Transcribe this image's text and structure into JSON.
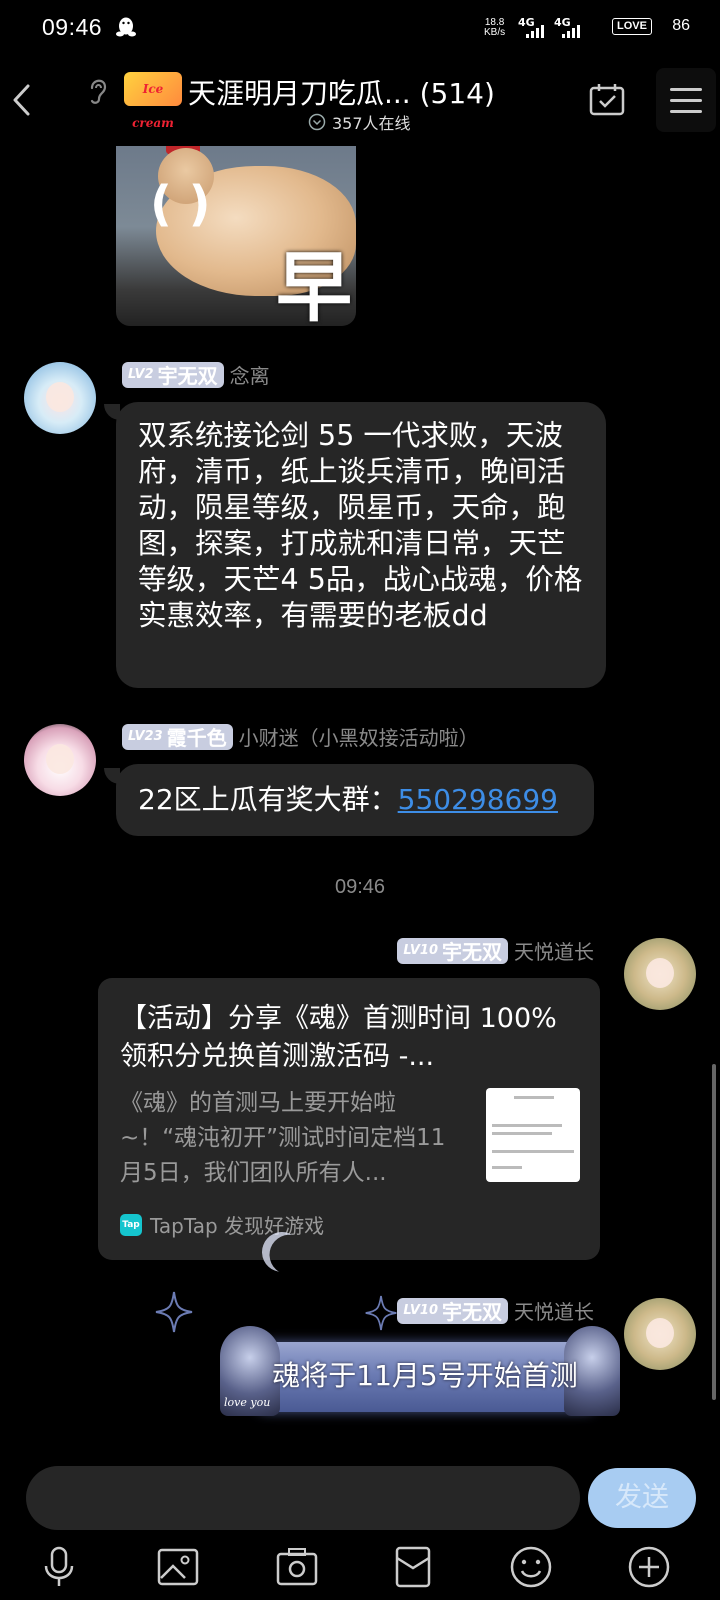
{
  "status_bar": {
    "time": "09:46",
    "net_speed_value": "18.8",
    "net_speed_unit": "KB/s",
    "sim1": "4G",
    "sim2": "4G",
    "battery_label": "LOVE",
    "battery_level": "86"
  },
  "header": {
    "title": "天涯明月刀吃瓜... (514)",
    "online": "357人在线",
    "logo_text": "Ice cream"
  },
  "messages": [
    {
      "type": "sticker",
      "sticker_text": "早"
    },
    {
      "side": "left",
      "badge_level": "LV2",
      "badge_title": "宇无双",
      "nickname": "念离",
      "text": "双系统接论剑 55 一代求败，天波府，清币，纸上谈兵清币，晚间活动，陨星等级，陨星币，天命，跑图，探案，打成就和清日常，天芒等级，天芒4 5品，战心战魂，价格实惠效率，有需要的老板dd"
    },
    {
      "side": "left",
      "badge_level": "LV23",
      "badge_title": "霞千色",
      "nickname": "小财迷（小黑奴接活动啦）",
      "text": "22区上瓜有奖大群：",
      "link": "550298699"
    },
    {
      "type": "timestamp",
      "text": "09:46"
    },
    {
      "side": "right",
      "badge_level": "LV10",
      "badge_title": "宇无双",
      "nickname": "天悦道长",
      "card": {
        "title": "【活动】分享《魂》首测时间 100%领积分兑换首测激活码 -...",
        "description": "《魂》的首测马上要开始啦~！“魂沌初开”测试时间定档11月5日，我们团队所有人...",
        "source_logo": "Tap",
        "source": "TapTap 发现好游戏"
      }
    },
    {
      "side": "right",
      "badge_level": "LV10",
      "badge_title": "宇无双",
      "nickname": "天悦道长",
      "text": "魂将于11月5号开始首测",
      "bubble_caption_left": "love you"
    }
  ],
  "input": {
    "placeholder": "",
    "send_label": "发送"
  },
  "toolbar": {
    "icons": [
      "microphone-icon",
      "image-icon",
      "camera-icon",
      "red-packet-icon",
      "emoji-icon",
      "plus-icon"
    ]
  },
  "colors": {
    "background": "#000000",
    "bubble": "#262626",
    "link": "#3d8de6",
    "badge": "#c8cde0",
    "send_button": "#a8ccf2"
  }
}
